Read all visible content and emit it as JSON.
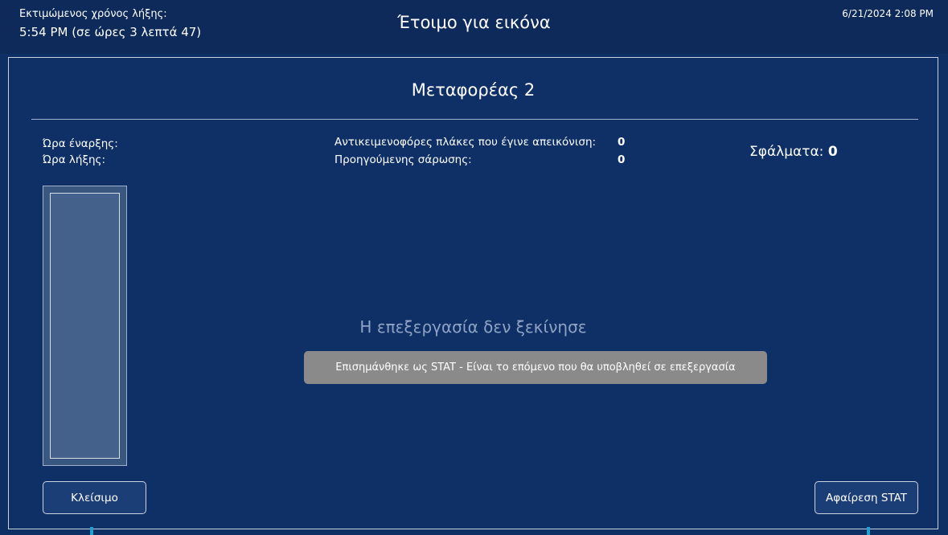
{
  "header": {
    "eta_label": "Εκτιμώμενος χρόνος λήξης:",
    "eta_value": "5:54 PM (σε ώρες 3 λεπτά 47)",
    "status": "Έτοιμο για εικόνα",
    "datetime": "6/21/2024 2:08 PM"
  },
  "panel": {
    "title": "Μεταφορέας 2",
    "start_label": "Ώρα έναρξης:",
    "end_label": "Ώρα λήξης:",
    "imaged_label": "Αντικειμενοφόρες πλάκες που έγινε απεικόνιση:",
    "imaged_value": "0",
    "previous_label": "Προηγούμενης σάρωσης:",
    "previous_value": "0",
    "errors_label": "Σφάλματα:",
    "errors_value": "0",
    "processing_message": "Η επεξεργασία δεν ξεκίνησε",
    "stat_banner": "Επισημάνθηκε ως STAT - Είναι το επόμενο που θα υποβληθεί σε επεξεργασία"
  },
  "buttons": {
    "close": "Κλείσιμο",
    "remove_stat": "Αφαίρεση STAT"
  },
  "colors": {
    "background": "#0e2f63",
    "stat_banner": "#8a8a8a",
    "accent": "#1fa2cf"
  }
}
